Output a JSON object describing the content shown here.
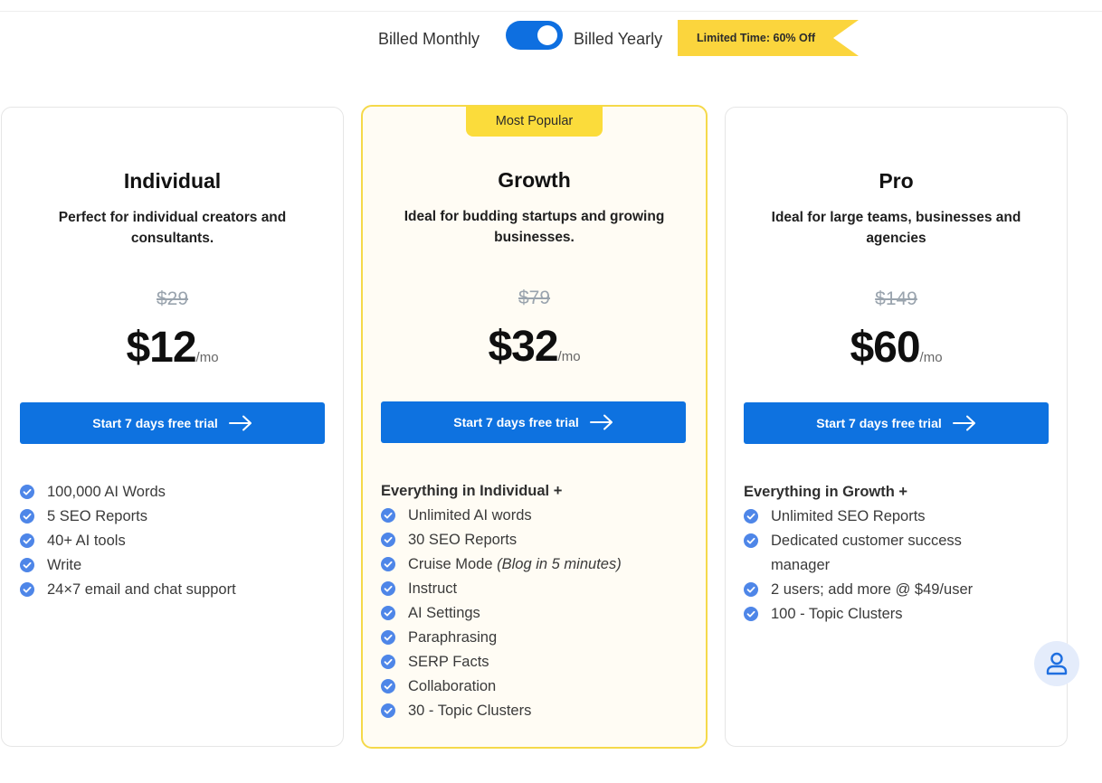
{
  "billing": {
    "monthly_label": "Billed Monthly",
    "yearly_label": "Billed Yearly",
    "yearly_selected": true,
    "promo": "Limited Time: 60% Off"
  },
  "colors": {
    "accent": "#0e72e0",
    "promo_yellow": "#fbd53d",
    "popular_border": "#f5d94a",
    "popular_bg": "#fffcf4",
    "check_blue": "#4e86e8"
  },
  "plans": [
    {
      "name": "Individual",
      "description": "Perfect for individual creators and consultants.",
      "old_price": "$29",
      "price": "$12",
      "period": "/mo",
      "cta": "Start 7 days free trial",
      "features_heading": "",
      "features": [
        "100,000 AI Words",
        "5 SEO Reports",
        "40+ AI tools",
        "Write",
        "24×7 email and chat support"
      ]
    },
    {
      "name": "Growth",
      "badge": "Most Popular",
      "description": "Ideal for budding startups and growing businesses.",
      "old_price": "$79",
      "price": "$32",
      "period": "/mo",
      "cta": "Start 7 days free trial",
      "features_heading": "Everything in Individual +",
      "features": [
        "Unlimited AI words",
        "30 SEO Reports",
        "Cruise Mode",
        "Instruct",
        "AI Settings",
        "Paraphrasing",
        "SERP Facts",
        "Collaboration",
        "30 - Topic Clusters"
      ],
      "cruise_note": "(Blog in 5 minutes)"
    },
    {
      "name": "Pro",
      "description": "Ideal for large teams, businesses and agencies",
      "old_price": "$149",
      "price": "$60",
      "period": "/mo",
      "cta": "Start 7 days free trial",
      "features_heading": "Everything in Growth +",
      "features": [
        "Unlimited SEO Reports",
        "Dedicated customer success manager",
        "2 users; add more @ $49/user",
        "100 - Topic Clusters"
      ]
    }
  ],
  "icons": {
    "check": "check-circle-icon",
    "arrow": "arrow-right-icon",
    "support": "user-icon"
  }
}
